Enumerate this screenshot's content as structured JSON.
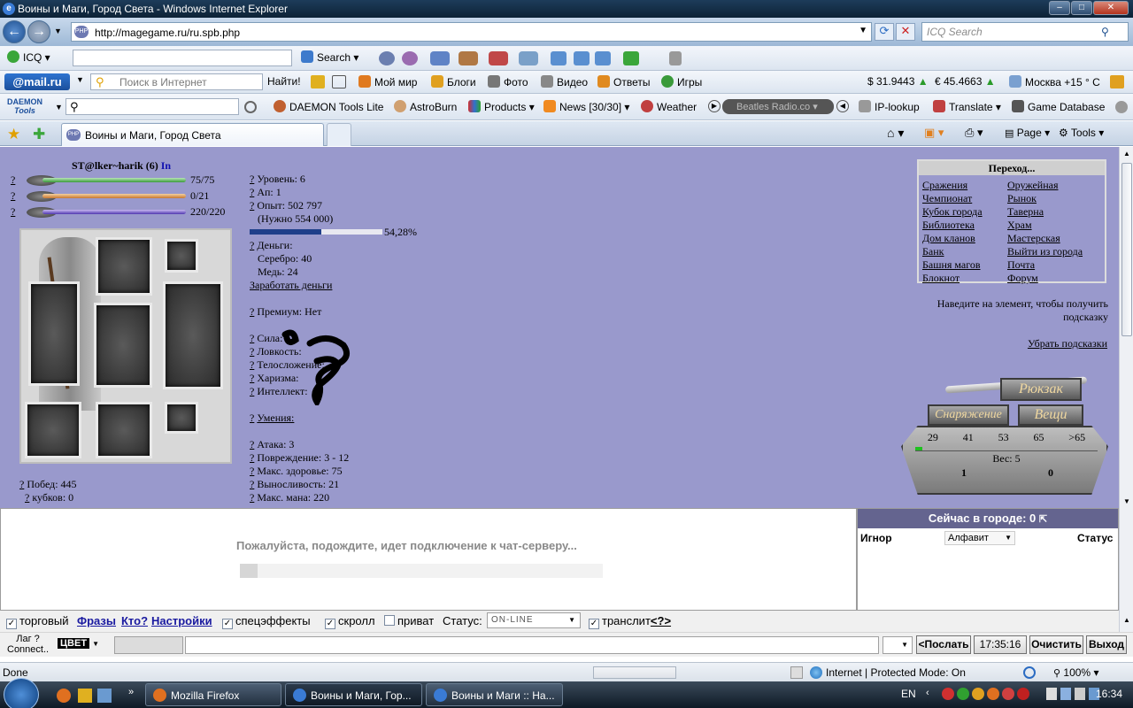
{
  "window": {
    "title": "Воины и Маги, Город Света - Windows Internet Explorer"
  },
  "address_bar": {
    "url": "http://magegame.ru/ru.spb.php",
    "search_placeholder": "ICQ Search"
  },
  "icq_toolbar": {
    "icq_label": "ICQ",
    "search_label": "Search"
  },
  "mail_toolbar": {
    "brand": "@mail.ru",
    "search_placeholder": "Поиск в Интернет",
    "find_button": "Найти!",
    "links": [
      "Мой мир",
      "Блоги",
      "Фото",
      "Видео",
      "Ответы",
      "Игры"
    ],
    "usd": "$ 31.9443",
    "eur": "€ 45.4663",
    "weather": "Москва +15 ° C"
  },
  "daemon_toolbar": {
    "brand_line1": "DAEMON",
    "brand_line2": "Tools",
    "items": [
      "DAEMON Tools Lite",
      "AstroBurn",
      "Products",
      "News [30/30]",
      "Weather",
      "Beatles Radio.co",
      "IP-lookup",
      "Translate",
      "Game Database"
    ]
  },
  "tabs": {
    "active_title": "Воины и Маги, Город Света",
    "page_menu": "Page",
    "tools_menu": "Tools"
  },
  "character": {
    "name": "ST@lker~harik (6)",
    "in_label": "In",
    "hp": "75/75",
    "hp_fraction": 1.0,
    "energy": "0/21",
    "energy_fraction": 1.0,
    "mana": "220/220",
    "mana_fraction": 1.0,
    "wins": "Побед: 445",
    "cups": "кубков: 0"
  },
  "stats": {
    "level": "Уровень: 6",
    "ap": "Ап: 1",
    "exp": "Опыт: 502 797",
    "exp_needed": "(Нужно 554 000)",
    "exp_percent": "54,28%",
    "exp_fraction": 0.5428,
    "money_label": "Деньги:",
    "silver": "Серебро: 40",
    "copper": "Медь: 24",
    "earn_money": "Заработать деньги",
    "premium": "Премиум: Нет",
    "strength": "Сила:",
    "agility": "Ловкость:",
    "constitution": "Телосложение:",
    "charisma": "Харизма:",
    "intellect": "Интеллект:",
    "skills": "Умения:",
    "attack": "Атака: 3",
    "damage": "Повреждение: 3 - 12",
    "max_health": "Макс. здоровье: 75",
    "endurance": "Выносливость: 21",
    "max_mana": "Макс. мана: 220"
  },
  "navigation": {
    "title": "Переход...",
    "left": [
      "Сражения",
      "Чемпионат",
      "Кубок города",
      "Библиотека",
      "Дом кланов",
      "Банк",
      "Башня магов",
      "Блокнот"
    ],
    "right": [
      "Оружейная",
      "Рынок",
      "Таверна",
      "Храм",
      "Мастерская",
      "Выйти из города",
      "Почта",
      "Форум"
    ]
  },
  "hint": {
    "text": "Наведите на элемент, чтобы получить подсказку",
    "remove": "Убрать подсказки"
  },
  "backpack": {
    "title": "Рюкзак",
    "equipment_tab": "Снаряжение",
    "things_tab": "Вещи",
    "scale": [
      "29",
      "41",
      "53",
      "65",
      ">65"
    ],
    "weight": "Вес: 5",
    "left_count": "1",
    "right_count": "0"
  },
  "chat": {
    "connecting": "Пожалуйста, подождите, идет подключение к чат-серверу..."
  },
  "users_panel": {
    "title": "Сейчас в городе: 0",
    "ignore": "Игнор",
    "sort": "Алфавит",
    "status": "Статус"
  },
  "chat_controls": {
    "trade": "торговый",
    "phrases": "Фразы",
    "who": "Кто?",
    "settings": "Настройки",
    "effects": "спецэффекты",
    "scroll": "скролл",
    "private": "приват",
    "status_label": "Статус:",
    "status_value": "ON-LINE",
    "translit": "транслит",
    "translit_help": "<?>",
    "lag_line1": "Лаг ?",
    "lag_line2": "Connect..",
    "color": "ЦВЕТ",
    "send": "<Послать",
    "time": "17:35:16",
    "clear": "Очистить",
    "exit": "Выход"
  },
  "status_bar": {
    "text": "Done",
    "zone": "Internet | Protected Mode: On",
    "zoom": "100%"
  },
  "taskbar": {
    "tasks": [
      "Mozilla Firefox",
      "Воины и Маги, Гор...",
      "Воины и Маги :: На..."
    ],
    "lang": "EN",
    "clock": "16:34"
  }
}
